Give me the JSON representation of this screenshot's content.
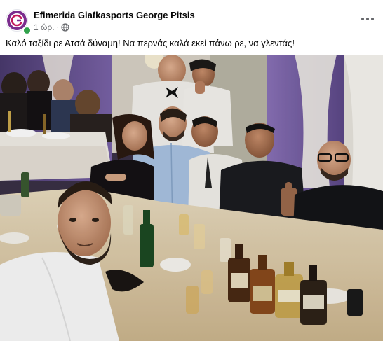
{
  "post": {
    "author": "Efimerida Giafkasports George Pitsis",
    "time": "1 ώρ.",
    "separator": "·",
    "privacy_icon": "globe-icon",
    "avatar_icon": "page-logo-icon",
    "more_icon": "more-options-icon",
    "caption": "Καλό ταξίδι ρε Ατσά δύναμη! Να περνάς καλά εκεί πάνω ρε, να γλεντάς!",
    "photo_description_icon": "group-selfie-photo"
  },
  "colors": {
    "author_text": "#050505",
    "meta_text": "#65676b",
    "online": "#31a24c",
    "logo_purple": "#7b2d8e",
    "wall_purple": "#7a63a8",
    "tablecloth": "#e9dcc0"
  }
}
